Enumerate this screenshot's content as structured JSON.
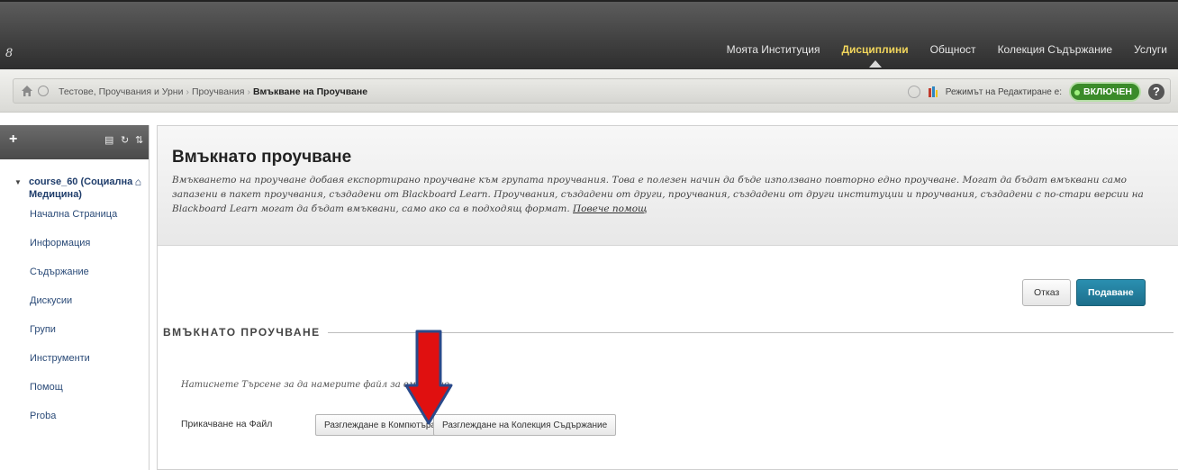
{
  "app": {
    "logo_text": "8"
  },
  "topnav": {
    "tabs": [
      {
        "label": "Моята Институция",
        "active": false
      },
      {
        "label": "Дисциплини",
        "active": true
      },
      {
        "label": "Общност",
        "active": false
      },
      {
        "label": "Колекция Съдържание",
        "active": false
      },
      {
        "label": "Услуги",
        "active": false
      }
    ]
  },
  "breadcrumb": {
    "items": [
      "Тестове, Проучвания и Урни",
      "Проучвания"
    ],
    "current": "Вмъкване на Проучване",
    "separator": "›",
    "edit_mode_label": "Режимът на Редактиране е:",
    "edit_mode_value": "ВКЛЮЧЕН",
    "help": "?"
  },
  "sidebar": {
    "add": "+",
    "course": "course_60 (Социална Медицина)",
    "items": [
      "Начална Страница",
      "Информация",
      "Съдържание",
      "Дискусии",
      "Групи",
      "Инструменти",
      "Помощ",
      "Proba"
    ]
  },
  "main": {
    "title": "Вмъкнато проучване",
    "description": "Вмъкването на проучване добавя експортирано проучване към групата проучвания. Това е полезен начин да бъде използвано повторно едно проучване. Могат да бъдат вмъквани само запазени в пакет проучвания, създадени от Blackboard Learn. Проучвания, създадени от други, проучвания, създадени от други институции и проучвания, създадени с по-стари версии на Blackboard Learn могат да бъдат вмъквани, само ако са в подходящ формат.",
    "more_help": "Повече помощ",
    "cancel_label": "Отказ",
    "submit_label": "Подаване",
    "section_title": "ВМЪКНАТО ПРОУЧВАНЕ",
    "hint": "Натиснете Търсене за да намерите файл за вмъкване",
    "attach_label": "Прикачване на Файл",
    "browse_computer": "Разглеждане в Компютъра",
    "browse_collection": "Разглеждане на Колекция Съдържание"
  },
  "colors": {
    "accent": "#1d6f8c",
    "active_tab": "#f2d65c",
    "toggle_on": "#3b8b2a",
    "annotation_arrow": "#e01010"
  }
}
